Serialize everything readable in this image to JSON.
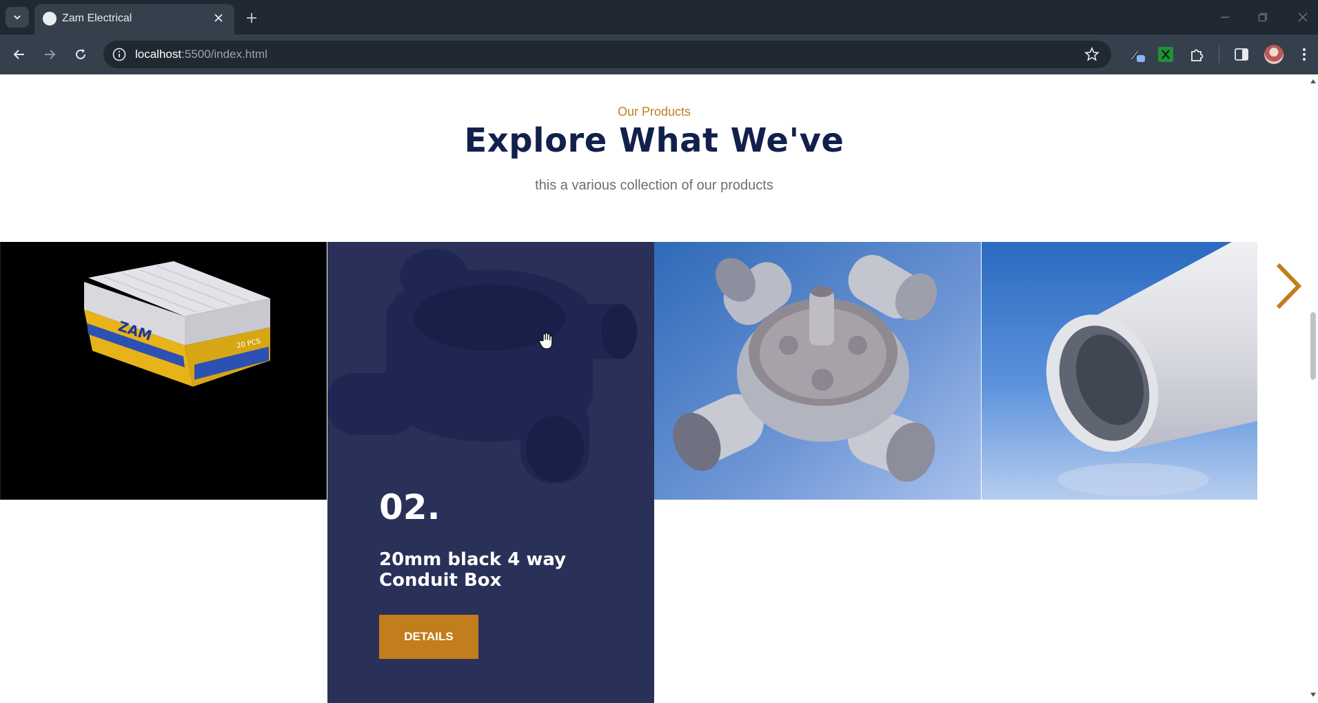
{
  "browser": {
    "tab_title": "Zam Electrical",
    "url_host": "localhost",
    "url_rest": ":5500/index.html"
  },
  "section": {
    "eyebrow": "Our Products",
    "title": "Explore What We've",
    "subtitle": "this a various collection of our products"
  },
  "products": [
    {
      "image": "boxed-mounting-boxes-image"
    },
    {
      "image": "black-4-way-conduit-box-image",
      "number": "02.",
      "title": "20mm black 4 way Conduit Box",
      "button": "DETAILS"
    },
    {
      "image": "grey-4-way-conduit-box-image"
    },
    {
      "image": "white-conduit-pipe-image"
    }
  ],
  "colors": {
    "accent": "#c27d1c",
    "title": "#12204c",
    "card_overlay": "#2a3159"
  },
  "icons": {
    "next": "chevron-right-icon"
  }
}
